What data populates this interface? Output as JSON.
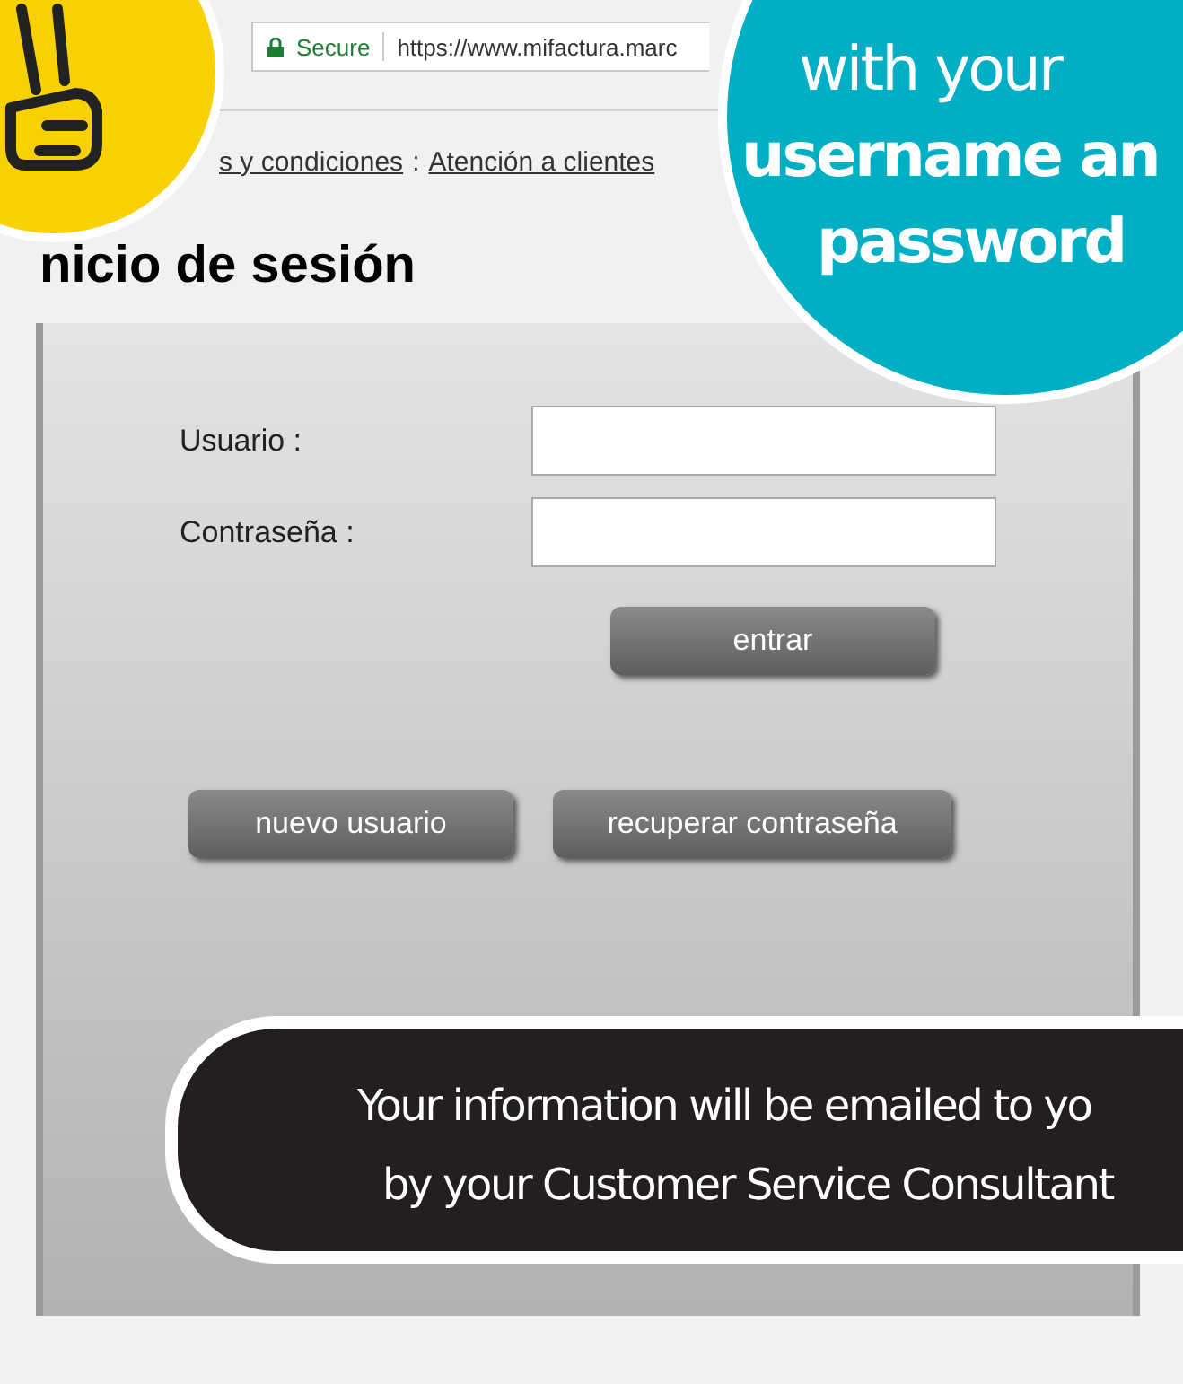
{
  "browser": {
    "secure_label": "Secure",
    "url": "https://www.mifactura.marc"
  },
  "links": [
    {
      "label": "s y condiciones"
    },
    {
      "label": "Atención a clientes"
    }
  ],
  "link_separator": ":",
  "page_title": "nicio de sesión",
  "form": {
    "fields": [
      {
        "label": "Usuario :"
      },
      {
        "label": "Contraseña :"
      }
    ],
    "submit": "entrar",
    "buttons": [
      "nuevo usuario",
      "recuperar contraseña"
    ]
  },
  "callout": {
    "lines": [
      {
        "text": "with your",
        "bold": false
      },
      {
        "text": "username an",
        "bold": true
      },
      {
        "text": "password",
        "bold": true
      }
    ]
  },
  "note": {
    "lines": [
      "Your information will be emailed to yo",
      "by your Customer Service Consultant"
    ]
  }
}
